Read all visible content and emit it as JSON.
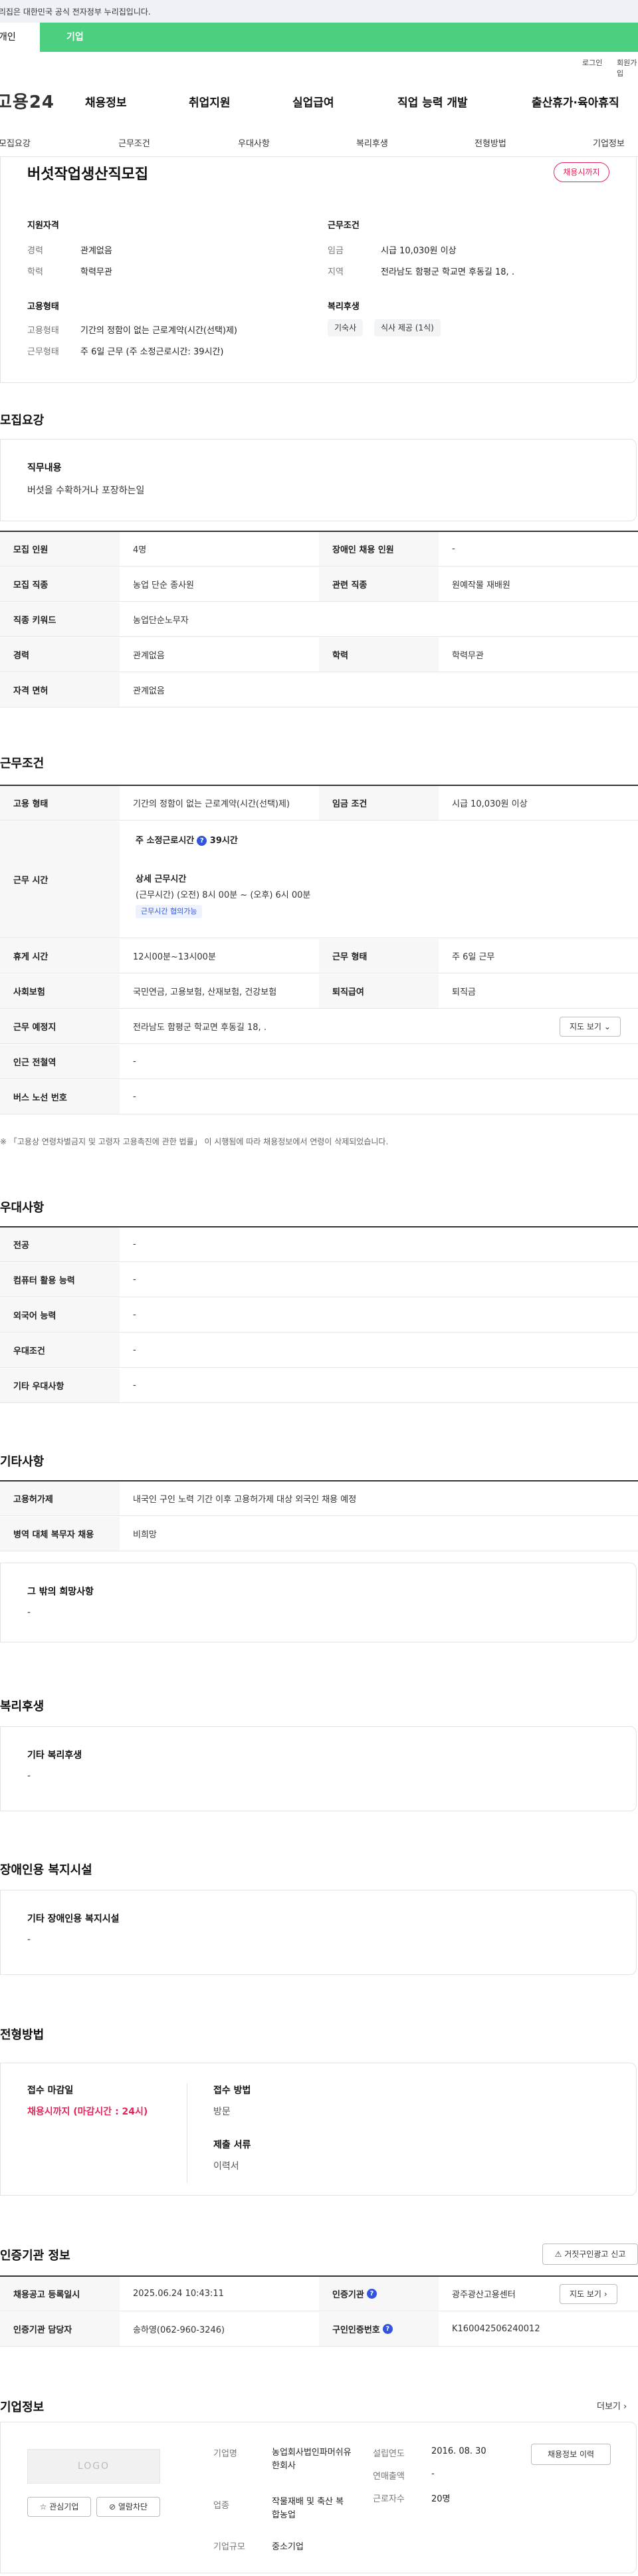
{
  "banner": {
    "text": "이 누리집은 대한민국 공식 전자정부 누리집입니다."
  },
  "top_tabs": {
    "active": "개인",
    "other": "기업"
  },
  "util": {
    "login": "로그인",
    "join": "회원가입"
  },
  "gnb": {
    "logo": "고용24",
    "items": [
      "채용정보",
      "취업지원",
      "실업급여",
      "직업 능력 개발",
      "출산휴가·육아휴직"
    ]
  },
  "subnav": [
    "모집요강",
    "근무조건",
    "우대사항",
    "복리후생",
    "전형방법",
    "기업정보"
  ],
  "job": {
    "title": "버섯작업생산직모집",
    "status_badge": "채용시까지",
    "qual_title": "지원자격",
    "career_k": "경력",
    "career_v": "관계없음",
    "edu_k": "학력",
    "edu_v": "학력무관",
    "emp_title": "고용형태",
    "emp_k": "고용형태",
    "emp_v": "기간의 정함이 없는 근로계약(시간(선택)제)",
    "work_k": "근무형태",
    "work_v": "주 6일 근무 (주 소정근로시간: 39시간)",
    "cond_title": "근무조건",
    "wage_k": "임금",
    "wage_v": "시급 10,030원 이상",
    "region_k": "지역",
    "region_v": "전라남도 함평군 학교면 후동길 18, .",
    "welfare_title": "복리후생",
    "chips": [
      "기숙사",
      "식사 제공 (1식)"
    ]
  },
  "recruit": {
    "section_title": "모집요강",
    "duty_title": "직무내용",
    "duty_value": "버섯을 수확하거나 포장하는일",
    "rows": [
      {
        "k1": "모집 인원",
        "v1": "4명",
        "k2": "장애인 채용 인원",
        "v2": "-"
      },
      {
        "k1": "모집 직종",
        "v1": "농업 단순 종사원",
        "k2": "관련 직종",
        "v2": "원예작물 재배원"
      },
      {
        "k1": "직종 키워드",
        "v1": "농업단순노무자"
      },
      {
        "k1": "경력",
        "v1": "관계없음",
        "k2": "학력",
        "v2": "학력무관"
      },
      {
        "k1": "자격 면허",
        "v1": "관계없음"
      }
    ]
  },
  "conditions": {
    "section_title": "근무조건",
    "emp_k": "고용 형태",
    "emp_v": "기간의 정함이 없는 근로계약(시간(선택)제)",
    "wage_k": "임금 조건",
    "wage_v": "시급 10,030원 이상",
    "time_k": "근무 시간",
    "weekly": "주 소정근로시간",
    "weekly_hours": "39시간",
    "detail_title": "상세 근무시간",
    "detail_value": "(근무시간) (오전) 8시 00분 ~ (오후) 6시 00분",
    "tag": "근무시간 협의가능",
    "rest_k": "휴게 시간",
    "rest_v": "12시00분~13시00분",
    "form_k": "근무 형태",
    "form_v": "주 6일 근무",
    "ins_k": "사회보험",
    "ins_v": "국민연금, 고용보험, 산재보험, 건강보험",
    "ret_k": "퇴직급여",
    "ret_v": "퇴직금",
    "place_k": "근무 예정지",
    "place_v": "전라남도 함평군 학교면 후동길 18, .",
    "map_btn": "지도 보기",
    "subway_k": "인근 전철역",
    "subway_v": "-",
    "bus_k": "버스 노선 번호",
    "bus_v": "-",
    "note": "※ 「고용상 연령차별금지 및 고령자 고용촉진에 관한 법률」 이 시행됨에 따라 채용정보에서 연령이 삭제되었습니다."
  },
  "prefer": {
    "section_title": "우대사항",
    "rows": [
      {
        "k": "전공",
        "v": "-"
      },
      {
        "k": "컴퓨터 활용 능력",
        "v": "-"
      },
      {
        "k": "외국어 능력",
        "v": "-"
      },
      {
        "k": "우대조건",
        "v": "-"
      },
      {
        "k": "기타 우대사항",
        "v": "-"
      }
    ]
  },
  "etc": {
    "section_title": "기타사항",
    "r1k": "고용허가제",
    "r1v": "내국인 구인 노력 기간 이후 고용허가제 대상 외국인 채용 예정",
    "r2k": "병역 대체 복무자 채용",
    "r2v": "비희망",
    "box_title": "그 밖의 희망사항",
    "box_value": "-"
  },
  "welfare": {
    "section_title": "복리후생",
    "box_title": "기타 복리후생",
    "box_value": "-"
  },
  "disabled": {
    "section_title": "장애인용 복지시설",
    "box_title": "기타 장애인용 복지시설",
    "box_value": "-"
  },
  "method": {
    "section_title": "전형방법",
    "deadline_k": "접수 마감일",
    "deadline_v": "채용시까지 (마감시간 : 24시)",
    "way_k": "접수 방법",
    "way_v": "방문",
    "docs_k": "제출 서류",
    "docs_v": "이력서"
  },
  "cert": {
    "section_title": "인증기관 정보",
    "report_btn": "거짓구인광고 신고",
    "reg_k": "채용공고 등록일시",
    "reg_v": "2025.06.24 10:43:11",
    "org_k": "인증기관",
    "org_v": "광주광산고용센터",
    "map_btn": "지도 보기",
    "mgr_k": "인증기관 담당자",
    "mgr_v": "송하영(062-960-3246)",
    "num_k": "구인인증번호",
    "num_v": "K160042506240012"
  },
  "company": {
    "section_title": "기업정보",
    "more": "더보기",
    "logo": "LOGO",
    "fav_btn": "관심기업",
    "block_btn": "열람차단",
    "name_k": "기업명",
    "name_v": "농업회사법인파머쉬유한회사",
    "ind_k": "업종",
    "ind_v": "작물재배 및 축산 복합농업",
    "size_k": "기업규모",
    "size_v": "중소기업",
    "est_k": "설립연도",
    "est_v": "2016. 08. 30",
    "sales_k": "연매출액",
    "sales_v": "-",
    "emp_k": "근로자수",
    "emp_v": "20명",
    "history_btn": "채용정보 이력"
  }
}
